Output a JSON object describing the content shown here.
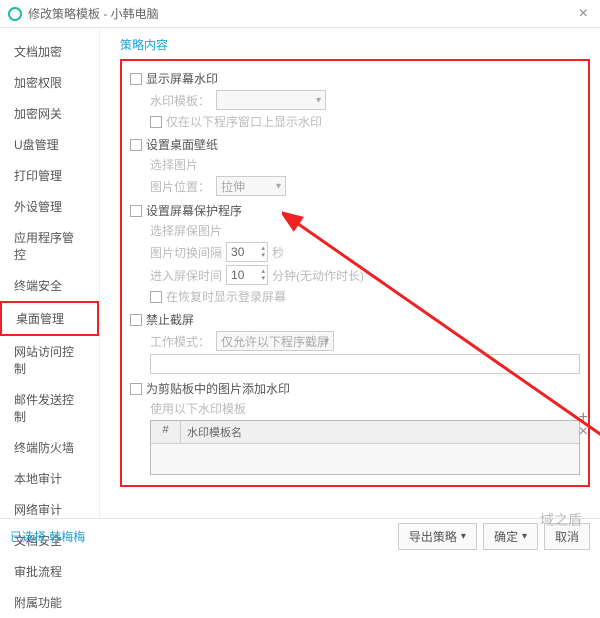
{
  "title": "修改策略模板 - 小韩电脑",
  "sidebar": {
    "items": [
      {
        "label": "文档加密"
      },
      {
        "label": "加密权限"
      },
      {
        "label": "加密网关"
      },
      {
        "label": "U盘管理"
      },
      {
        "label": "打印管理"
      },
      {
        "label": "外设管理"
      },
      {
        "label": "应用程序管控"
      },
      {
        "label": "终端安全"
      },
      {
        "label": "桌面管理"
      },
      {
        "label": "网站访问控制"
      },
      {
        "label": "邮件发送控制"
      },
      {
        "label": "终端防火墙"
      },
      {
        "label": "本地审计"
      },
      {
        "label": "网络审计"
      },
      {
        "label": "文档安全"
      },
      {
        "label": "审批流程"
      },
      {
        "label": "附属功能"
      }
    ],
    "active_index": 8
  },
  "content": {
    "section_title": "策略内容",
    "watermark": {
      "enable": "显示屏幕水印",
      "template_label": "水印模板：",
      "only_below": "仅在以下程序窗口上显示水印"
    },
    "wallpaper": {
      "enable": "设置桌面壁纸",
      "select_image": "选择图片",
      "position_label": "图片位置：",
      "position_value": "拉伸"
    },
    "screensaver": {
      "enable": "设置屏幕保护程序",
      "select_image": "选择屏保图片",
      "interval_label": "图片切换间隔",
      "interval_value": "30",
      "interval_unit": "秒",
      "enter_label": "进入屏保时间",
      "enter_value": "10",
      "enter_unit": "分钟(无动作时长)",
      "show_login": "在恢复时显示登录屏幕"
    },
    "screenshot": {
      "enable": "禁止截屏",
      "mode_label": "工作模式：",
      "mode_value": "仅允许以下程序截屏"
    },
    "clipboard": {
      "enable": "为剪贴板中的图片添加水印",
      "use_template": "使用以下水印模板",
      "table": {
        "col1": "#",
        "col2": "水印模板名"
      }
    }
  },
  "footer": {
    "selected_prefix": "已选择",
    "selected_name": "韩梅梅",
    "export": "导出策略",
    "ok": "确定",
    "cancel": "取消"
  },
  "watermark_text": "域之盾"
}
